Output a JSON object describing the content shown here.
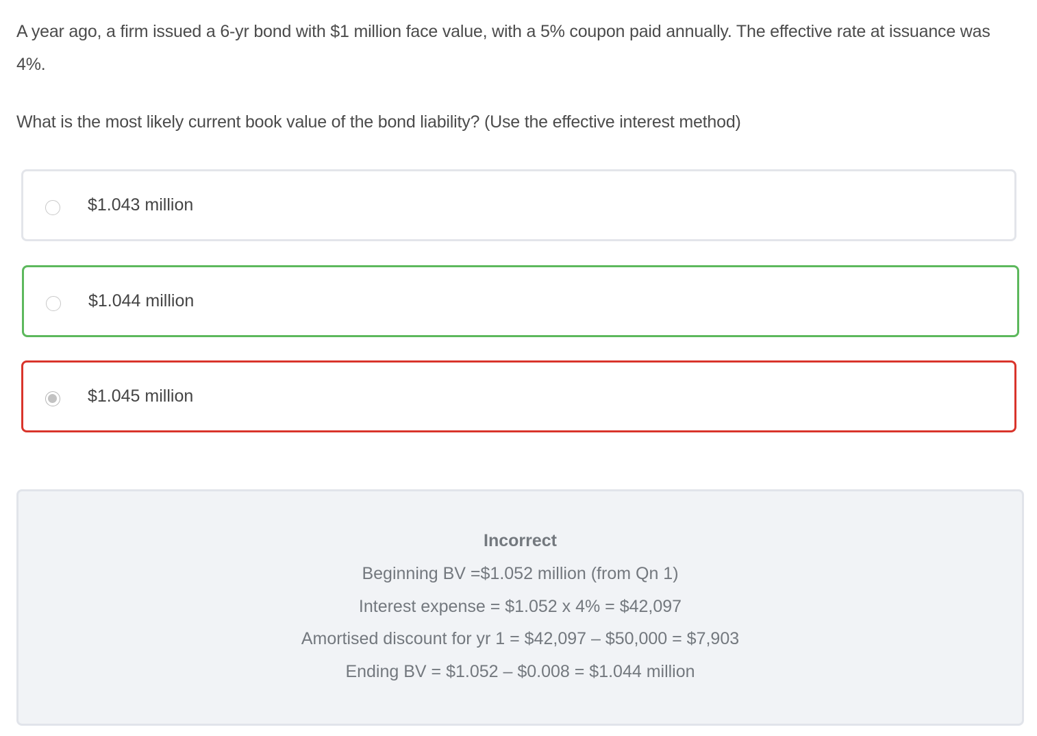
{
  "question": {
    "text_1": "A year ago, a firm issued a 6-yr bond with $1 million face value, with a 5% coupon paid annually.  The effective rate at issuance was 4%.",
    "text_2": "What is the most likely current book value of the bond liability? (Use the effective interest method)"
  },
  "options": [
    {
      "label": "$1.043 million",
      "state": "neutral",
      "selected": false
    },
    {
      "label": "$1.044 million",
      "state": "correct",
      "selected": false
    },
    {
      "label": "$1.045 million",
      "state": "incorrect",
      "selected": true
    }
  ],
  "feedback": {
    "status": "Incorrect",
    "lines": [
      "Beginning BV =$1.052 million (from Qn 1)",
      "Interest expense = $1.052 x 4% = $42,097",
      "Amortised discount for yr 1 = $42,097 – $50,000 = $7,903",
      "Ending BV = $1.052 – $0.008 = $1.044 million"
    ]
  },
  "colors": {
    "correct_border": "#5cb85c",
    "incorrect_border": "#d9342b",
    "neutral_border": "#e3e5ea",
    "feedback_bg": "#f1f3f6"
  }
}
